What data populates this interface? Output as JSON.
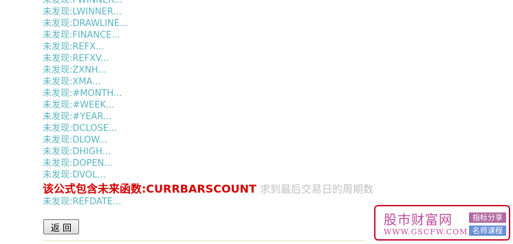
{
  "results": [
    "未发现:FWINNER...",
    "未发现:LWINNER...",
    "未发现:DRAWLINE...",
    "未发现:FINANCE...",
    "未发现:REFX...",
    "未发现:REFXV...",
    "未发现:ZXNH...",
    "未发现:XMA...",
    "未发现:#MONTH...",
    "未发现:#WEEK...",
    "未发现:#YEAR...",
    "未发现:DCLOSE...",
    "未发现:DLOW...",
    "未发现:DHIGH...",
    "未发现:DOPEN...",
    "未发现:DVOL..."
  ],
  "warning": {
    "text": "该公式包含未来函数:CURRBARSCOUNT",
    "description": "求到最后交易日的周期数"
  },
  "results_after": [
    "未发现:REFDATE..."
  ],
  "back_button_label": "返 回",
  "watermark": {
    "name": "股市财富网",
    "url": "WWW.GSCFW.COM",
    "tag1": "指标分享",
    "tag2": "名师课程"
  },
  "colors": {
    "result_text": "#5bb5c0",
    "warning_text": "#d40000",
    "warning_desc": "#c0c0c0",
    "watermark_border": "#c8102e",
    "watermark_text": "#c04aa0"
  }
}
